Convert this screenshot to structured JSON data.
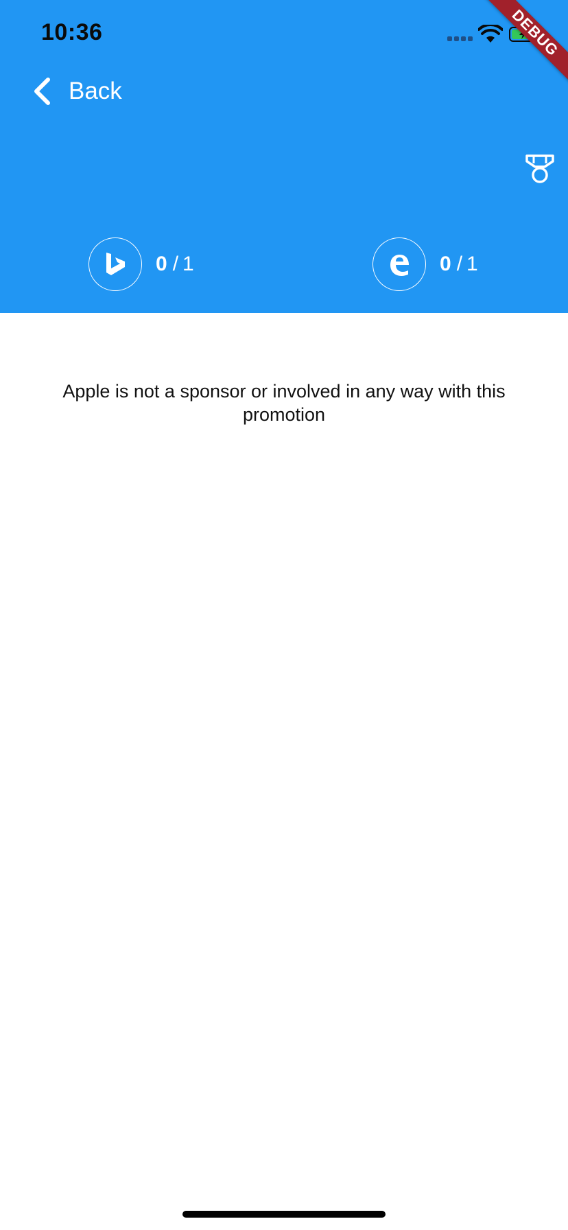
{
  "status_bar": {
    "time": "10:36"
  },
  "debug_banner": {
    "label": "DEBUG"
  },
  "nav": {
    "back_label": "Back"
  },
  "progress": {
    "bing": {
      "current": "0",
      "total": "1",
      "icon": "bing-icon"
    },
    "edge": {
      "current": "0",
      "total": "1",
      "icon": "edge-icon"
    }
  },
  "disclaimer": {
    "text": "Apple is not a sponsor or involved in any way with this promotion"
  },
  "colors": {
    "header": "#2196F3",
    "debug_ribbon": "#A1212B",
    "text_on_header": "#FFFFFF",
    "body_text": "#111111"
  }
}
